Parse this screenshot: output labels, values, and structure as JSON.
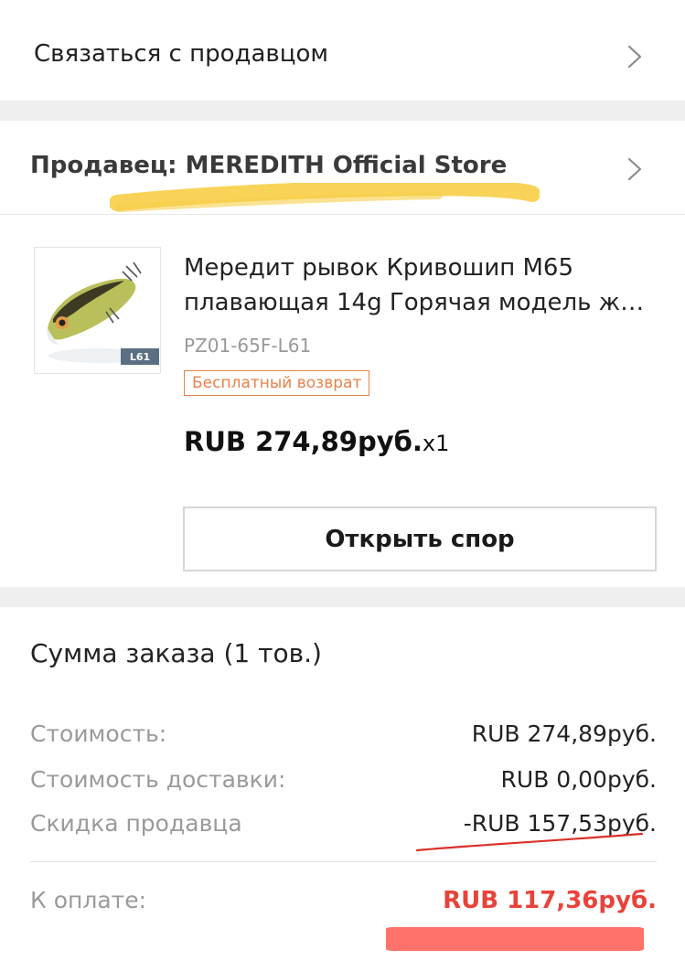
{
  "contact": {
    "label": "Связаться с продавцом"
  },
  "seller": {
    "label": "Продавец: MEREDITH Official Store"
  },
  "product": {
    "title_line1": "Мередит рывок Кривошип M65",
    "title_line2": "плавающая 14g Горячая модель же...",
    "sku": "PZ01-65F-L61",
    "badge": "Бесплатный возврат",
    "price": "RUB 274,89руб.",
    "quantity": "x1",
    "thumb_tag": "L61"
  },
  "actions": {
    "dispute_label": "Открыть спор"
  },
  "summary": {
    "title": "Сумма заказа (1 тов.)",
    "rows": [
      {
        "label": "Стоимость:",
        "value": "RUB 274,89руб."
      },
      {
        "label": "Стоимость доставки:",
        "value": "RUB 0,00руб."
      },
      {
        "label": "Скидка продавца",
        "value": "-RUB 157,53руб."
      }
    ],
    "total_label": "К оплате:",
    "total_value": "RUB 117,36руб."
  },
  "colors": {
    "accent_red": "#e8433a",
    "badge_orange": "#e8814a",
    "highlight_yellow": "#f7cf4a",
    "divider_gray": "#efefef"
  }
}
